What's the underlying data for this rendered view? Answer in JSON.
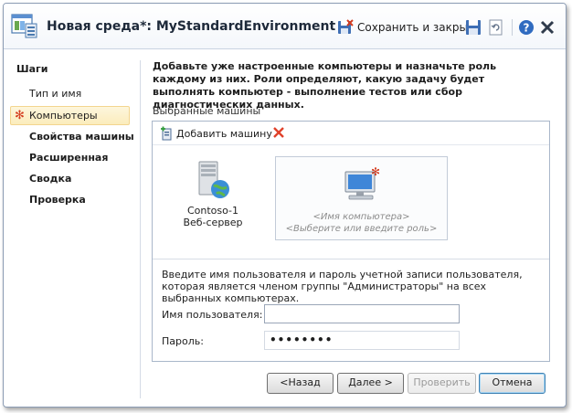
{
  "window": {
    "title": "Новая среда*: MyStandardEnvironment",
    "save_and_close": "Сохранить и закрыть"
  },
  "sidebar": {
    "heading": "Шаги",
    "steps": [
      {
        "label": "Тип и имя",
        "bold": false,
        "active": false
      },
      {
        "label": "Компьютеры",
        "bold": false,
        "active": true
      },
      {
        "label": "Свойства машины",
        "bold": true,
        "active": false
      },
      {
        "label": "Расширенная",
        "bold": true,
        "active": false
      },
      {
        "label": "Сводка",
        "bold": true,
        "active": false
      },
      {
        "label": "Проверка",
        "bold": true,
        "active": false
      }
    ]
  },
  "main": {
    "intro": "Добавьте уже настроенные компьютеры и назначьте роль каждому из них. Роли определяют, какую задачу будет выполнять компьютер - выполнение тестов или сбор диагностических данных.",
    "selected_machines_label": "Выбранные машины",
    "add_machine": "Добавить машину",
    "machines": [
      {
        "name": "Contoso-1",
        "role": "Веб-сервер",
        "icon": "server-icon"
      }
    ],
    "new_machine": {
      "name_placeholder": "<Имя компьютера>",
      "role_placeholder": "<Выберите или введите роль>",
      "icon": "computer-icon"
    },
    "credentials": {
      "text": "Введите имя пользователя и пароль учетной записи пользователя, которая является членом группы \"Администраторы\" на всех выбранных компьютерах.",
      "username_label": "Имя пользователя:",
      "username_value": "",
      "password_label": "Пароль:",
      "password_value": "••••••••"
    }
  },
  "footer": {
    "back": "<Назад",
    "next": "Далее >",
    "verify": "Проверить",
    "cancel": "Отмена"
  },
  "colors": {
    "accent_border": "#8c9cb4",
    "active_step_bg": "#fbecbc",
    "required_star": "#d43b1e"
  }
}
